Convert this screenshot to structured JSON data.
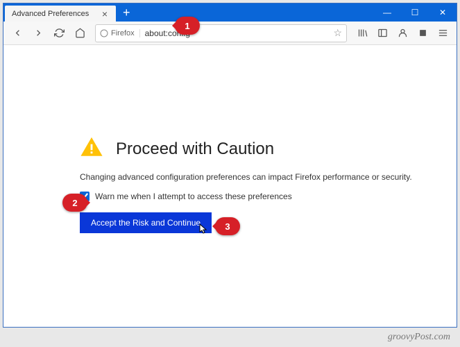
{
  "tab": {
    "title": "Advanced Preferences"
  },
  "urlbar": {
    "identity": "Firefox",
    "url": "about:config"
  },
  "warning": {
    "heading": "Proceed with Caution",
    "desc": "Changing advanced configuration preferences can impact Firefox performance or security.",
    "checkbox_label": "Warn me when I attempt to access these preferences",
    "button": "Accept the Risk and Continue"
  },
  "callouts": {
    "one": "1",
    "two": "2",
    "three": "3"
  },
  "watermark": "groovyPost.com"
}
